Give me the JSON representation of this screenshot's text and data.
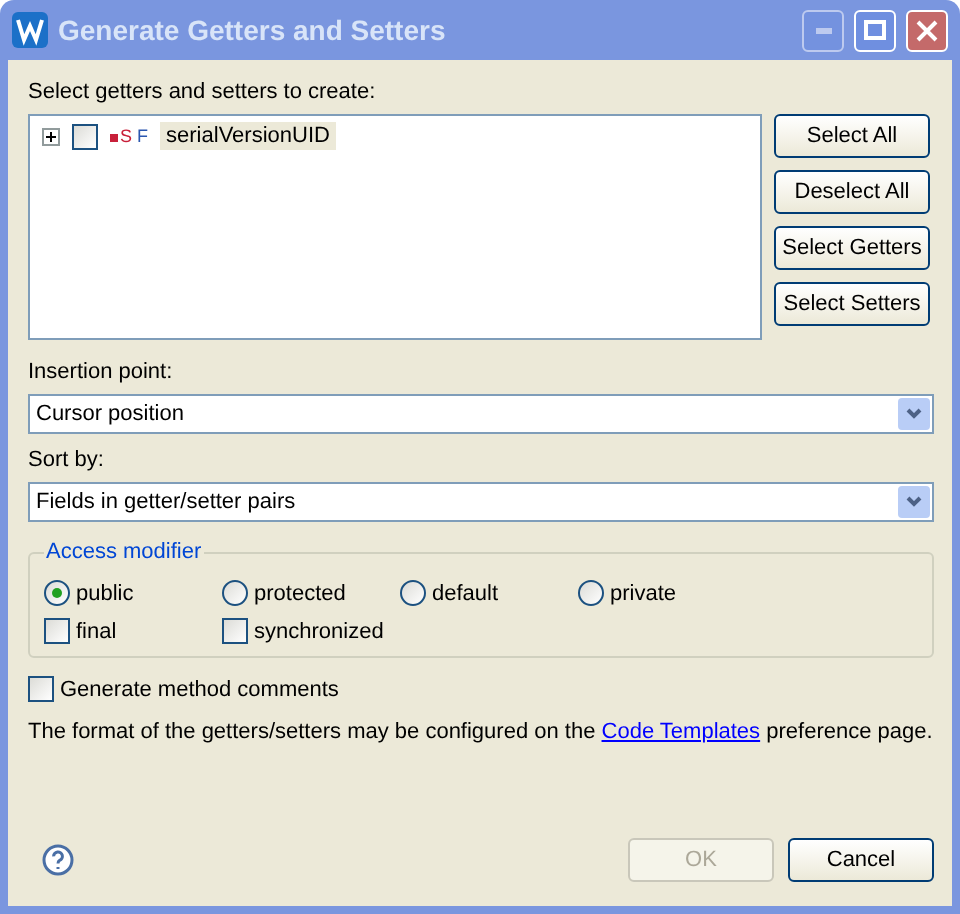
{
  "window": {
    "title": "Generate Getters and Setters",
    "active": false
  },
  "members": {
    "label": "Select getters and setters to create:",
    "items": [
      {
        "name": "serialVersionUID",
        "badge_1": "S",
        "badge_2": "F",
        "checked": false,
        "expanded": false,
        "selected": true
      }
    ]
  },
  "side_buttons": [
    "Select All",
    "Deselect All",
    "Select Getters",
    "Select Setters"
  ],
  "insertion_point": {
    "label": "Insertion point:",
    "value": "Cursor position"
  },
  "sort_by": {
    "label": "Sort by:",
    "value": "Fields in getter/setter pairs"
  },
  "access_modifier": {
    "title": "Access modifier",
    "options": [
      {
        "label": "public",
        "selected": true
      },
      {
        "label": "protected",
        "selected": false
      },
      {
        "label": "default",
        "selected": false
      },
      {
        "label": "private",
        "selected": false
      }
    ],
    "flags": [
      {
        "label": "final",
        "checked": false
      },
      {
        "label": "synchronized",
        "checked": false
      }
    ]
  },
  "generate_comments": {
    "label": "Generate method comments",
    "checked": false
  },
  "note": {
    "before": "The format of the getters/setters may be configured on the ",
    "link": "Code Templates",
    "after": " preference page."
  },
  "buttons": [
    {
      "label": "OK",
      "disabled": true
    },
    {
      "label": "Cancel",
      "disabled": false
    }
  ]
}
